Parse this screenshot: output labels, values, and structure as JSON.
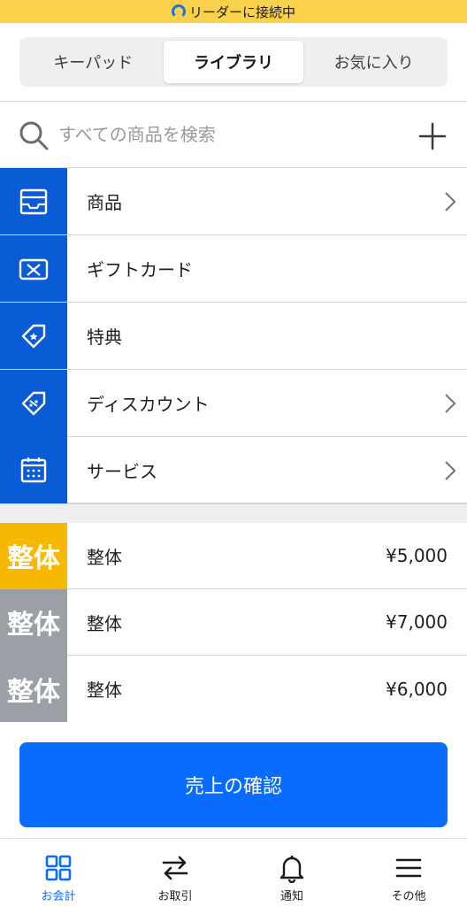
{
  "status_bar": {
    "text": "リーダーに接続中",
    "color": "#f9d14a"
  },
  "segmented": {
    "tabs": [
      {
        "label": "キーパッド",
        "active": false
      },
      {
        "label": "ライブラリ",
        "active": true
      },
      {
        "label": "お気に入り",
        "active": false
      }
    ]
  },
  "search": {
    "placeholder": "すべての商品を検索",
    "value": ""
  },
  "categories": [
    {
      "label": "商品",
      "icon": "inbox-tray-icon",
      "has_chevron": true
    },
    {
      "label": "ギフトカード",
      "icon": "gift-card-icon",
      "has_chevron": false
    },
    {
      "label": "特典",
      "icon": "star-tag-icon",
      "has_chevron": false
    },
    {
      "label": "ディスカウント",
      "icon": "discount-tag-icon",
      "has_chevron": true
    },
    {
      "label": "サービス",
      "icon": "calendar-icon",
      "has_chevron": true
    }
  ],
  "items": [
    {
      "thumb_text": "整体",
      "thumb_color": "#f6b800",
      "name": "整体",
      "price": "¥5,000"
    },
    {
      "thumb_text": "整体",
      "thumb_color": "#9aa0a6",
      "name": "整体",
      "price": "¥7,000"
    },
    {
      "thumb_text": "整体",
      "thumb_color": "#9aa0a6",
      "name": "整体",
      "price": "¥6,000"
    }
  ],
  "sales_button": {
    "label": "売上の確認"
  },
  "tabbar": [
    {
      "label": "お会計",
      "icon": "grid-icon",
      "active": true
    },
    {
      "label": "お取引",
      "icon": "transfer-arrows-icon",
      "active": false
    },
    {
      "label": "通知",
      "icon": "bell-icon",
      "active": false
    },
    {
      "label": "その他",
      "icon": "menu-icon",
      "active": false
    }
  ],
  "colors": {
    "accent": "#0a6cff",
    "category_bg": "#0a5bd6",
    "active_tab": "#0a6cff"
  }
}
